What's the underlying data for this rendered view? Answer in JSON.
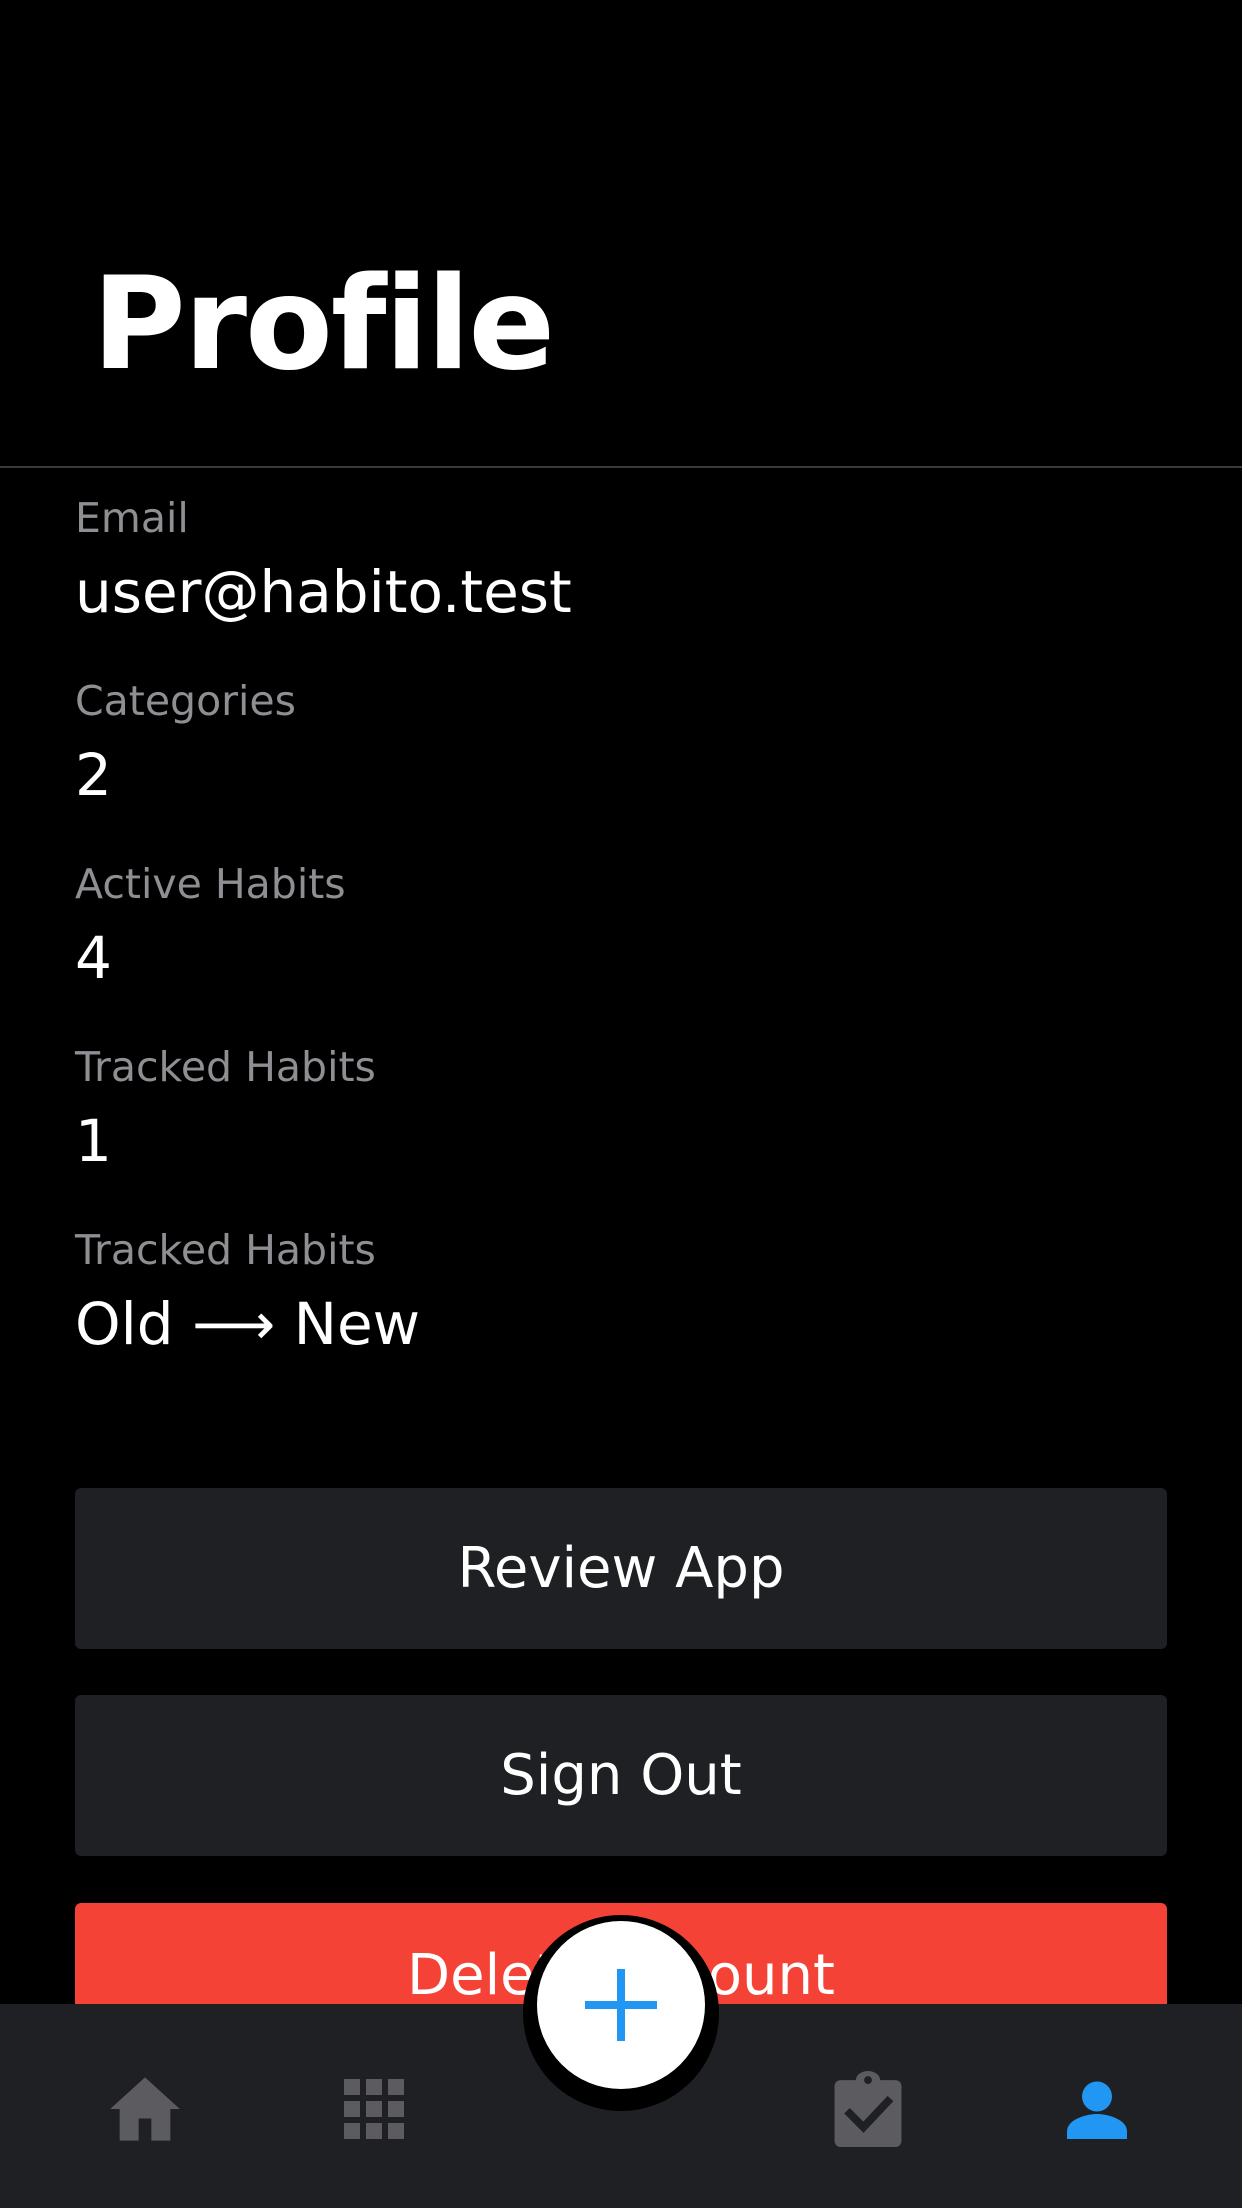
{
  "header": {
    "title": "Profile"
  },
  "stats": [
    {
      "label": "Email",
      "value": "user@habito.test"
    },
    {
      "label": "Categories",
      "value": "2"
    },
    {
      "label": "Active Habits",
      "value": "4"
    },
    {
      "label": "Tracked Habits",
      "value": "1"
    },
    {
      "label": "Tracked Habits",
      "value": "Old ⟶ New"
    }
  ],
  "actions": {
    "review_label": "Review App",
    "signout_label": "Sign Out",
    "delete_label": "Delete Account"
  },
  "tabbar": {
    "items": [
      {
        "icon": "home-icon",
        "active": false
      },
      {
        "icon": "grid-icon",
        "active": false
      },
      {
        "icon": "plus-icon",
        "active": false
      },
      {
        "icon": "clipboard-check-icon",
        "active": false
      },
      {
        "icon": "person-icon",
        "active": true
      }
    ]
  },
  "colors": {
    "accent": "#2196f3",
    "danger": "#f44336",
    "surface": "#1f2023",
    "inactive_icon": "#5c5c60"
  }
}
